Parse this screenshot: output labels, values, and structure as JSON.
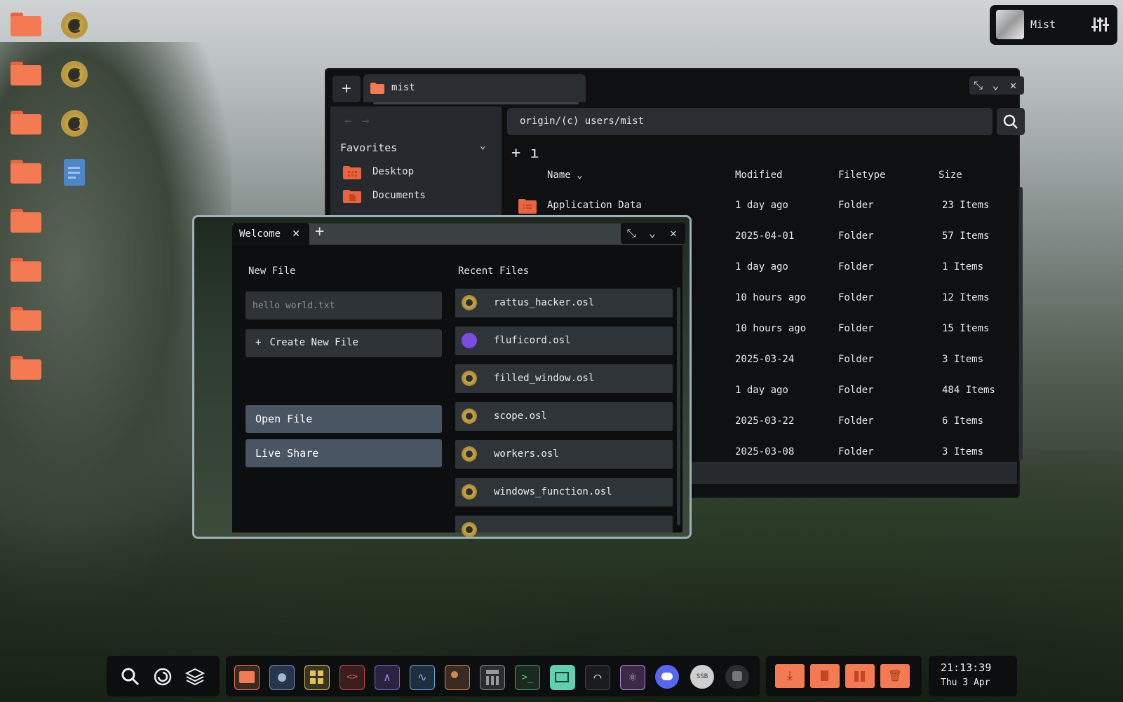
{
  "profile": {
    "name": "Mist",
    "settings_icon": "sliders-icon"
  },
  "file_manager": {
    "tab_label": "mist",
    "path": "origin/(c) users/mist",
    "sidebar": {
      "section_title": "Favorites",
      "items": [
        {
          "label": "Desktop"
        },
        {
          "label": "Documents"
        }
      ]
    },
    "columns": {
      "name": "Name",
      "modified": "Modified",
      "filetype": "Filetype",
      "size": "Size"
    },
    "rows": [
      {
        "name": "Application Data",
        "modified": "1 day ago",
        "type": "Folder",
        "size": "23 Items"
      },
      {
        "name": "",
        "modified": "2025-04-01",
        "type": "Folder",
        "size": "57 Items"
      },
      {
        "name": "",
        "modified": "1 day ago",
        "type": "Folder",
        "size": "1 Items"
      },
      {
        "name": "",
        "modified": "10 hours ago",
        "type": "Folder",
        "size": "12 Items"
      },
      {
        "name": "",
        "modified": "10 hours ago",
        "type": "Folder",
        "size": "15 Items"
      },
      {
        "name": "",
        "modified": "2025-03-24",
        "type": "Folder",
        "size": "3 Items"
      },
      {
        "name": "",
        "modified": "1 day ago",
        "type": "Folder",
        "size": "484 Items"
      },
      {
        "name": "",
        "modified": "2025-03-22",
        "type": "Folder",
        "size": "6 Items"
      },
      {
        "name": "",
        "modified": "2025-03-08",
        "type": "Folder",
        "size": "3 Items"
      }
    ]
  },
  "welcome": {
    "tab_label": "Welcome",
    "new_file_title": "New File",
    "new_file_placeholder": "hello world.txt",
    "create_label": "Create New File",
    "open_label": "Open File",
    "live_share_label": "Live Share",
    "recent_title": "Recent Files",
    "recent": [
      {
        "name": "rattus_hacker.osl",
        "icon": "originos-gear-icon"
      },
      {
        "name": "fluficord.osl",
        "icon": "discord-icon"
      },
      {
        "name": "filled_window.osl",
        "icon": "originos-gear-icon"
      },
      {
        "name": "scope.osl",
        "icon": "originos-gear-icon"
      },
      {
        "name": "workers.osl",
        "icon": "originos-gear-icon"
      },
      {
        "name": "windows_function.osl",
        "icon": "originos-gear-icon"
      }
    ]
  },
  "taskbar": {
    "clock_time": "21:13:39",
    "clock_date": "Thu 3 Apr"
  },
  "colors": {
    "folder": "#f47a53",
    "window_bg": "#0e1012",
    "panel": "#2a2e32",
    "button": "#4a5a6a",
    "accent_border": "#9fb0b8"
  }
}
